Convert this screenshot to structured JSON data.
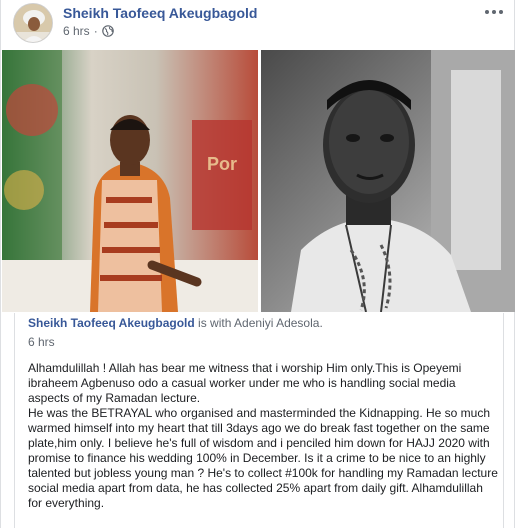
{
  "post": {
    "author": "Sheikh Taofeeq Akeugbagold",
    "time": "6 hrs",
    "separator": "·",
    "icons": {
      "more": "more-options-icon",
      "audience": "globe-icon"
    }
  },
  "shared": {
    "author": "Sheikh Taofeeq Akeugbagold",
    "is_with": "is with",
    "tagged": "Adeniyi Adesola",
    "period": ".",
    "time": "6 hrs",
    "paragraphs": [
      "Alhamdulillah ! Allah has bear me witness that i worship Him only.This is Opeyemi ibraheem Agbenuso odo a casual worker under me who is handling social media aspects of my Ramadan lecture.",
      "He was the BETRAYAL who organised and masterminded the Kidnapping. He so much warmed himself into my heart that till 3days ago we do break fast together on the same plate,him only. I believe he's full of wisdom and i penciled him down for HAJJ 2020 with promise to finance his wedding 100% in December. Is it a crime to be nice to an highly talented but jobless young man ? He's to collect #100k for handling my Ramadan lecture social media apart from data, he has collected 25% apart from daily gift. Alhamdulillah for everything."
    ]
  },
  "colors": {
    "link": "#385898",
    "meta": "#606770",
    "text": "#1c1e21"
  }
}
